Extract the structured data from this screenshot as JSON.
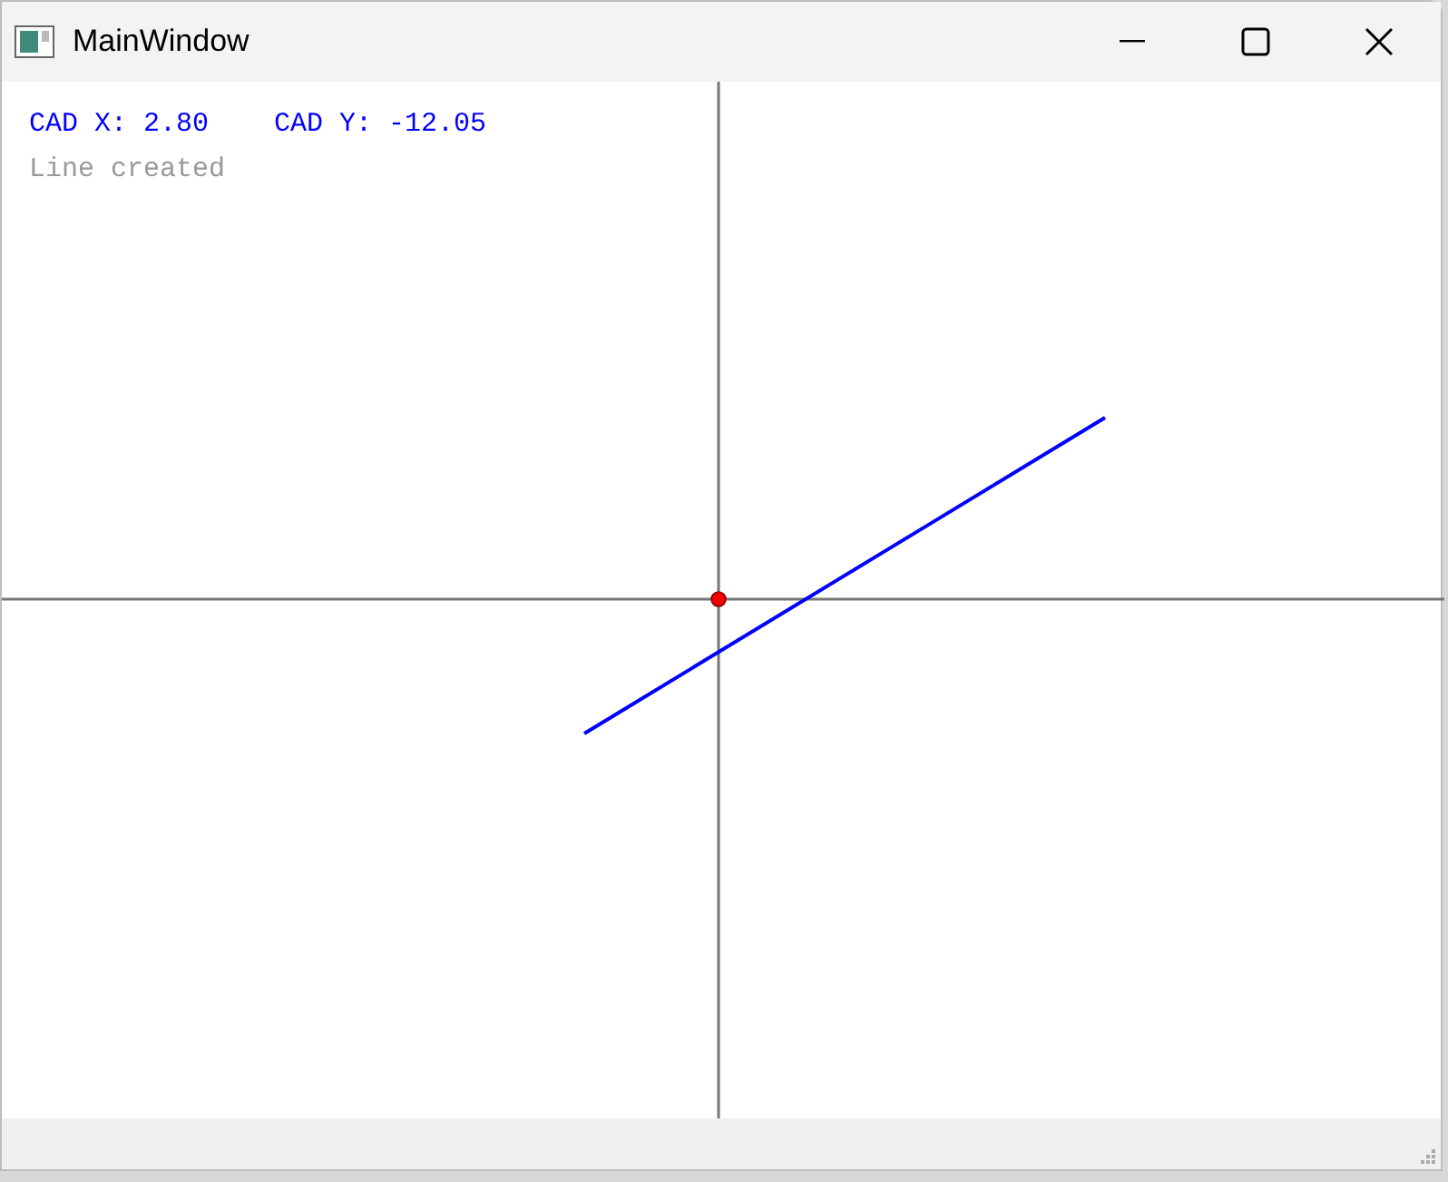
{
  "window": {
    "title": "MainWindow"
  },
  "canvas": {
    "readouts": [
      {
        "label": "CAD X: 2.80"
      },
      {
        "label": "CAD Y: -12.05"
      }
    ],
    "message": "Line created"
  }
}
